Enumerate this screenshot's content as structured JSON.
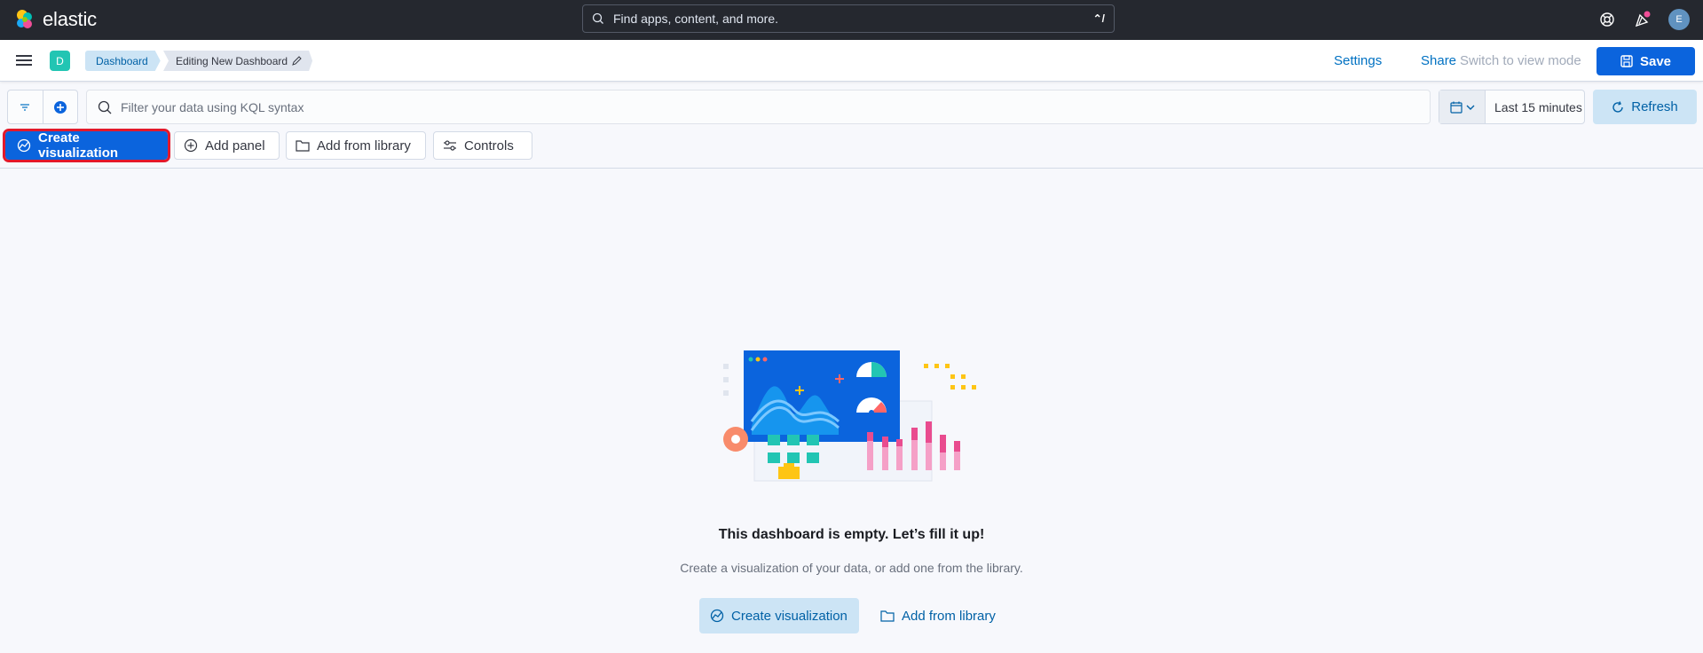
{
  "header": {
    "logo_text": "elastic",
    "search_placeholder": "Find apps, content, and more.",
    "search_shortcut": "⌃/",
    "avatar_initial": "E"
  },
  "app_bar": {
    "space_initial": "D",
    "breadcrumbs": [
      "Dashboard",
      "Editing New Dashboard"
    ],
    "settings_label": "Settings",
    "share_label": "Share",
    "view_mode_label": "Switch to view mode",
    "save_label": "Save"
  },
  "query_bar": {
    "placeholder": "Filter your data using KQL syntax",
    "time_range": "Last 15 minutes",
    "refresh_label": "Refresh"
  },
  "toolbar": {
    "create_visualization": "Create visualization",
    "add_panel": "Add panel",
    "add_from_library": "Add from library",
    "controls": "Controls"
  },
  "empty_state": {
    "title": "This dashboard is empty. Let’s fill it up!",
    "subtitle": "Create a visualization of your data, or add one from the library.",
    "create_label": "Create visualization",
    "library_label": "Add from library"
  },
  "colors": {
    "header_bg": "#25282f",
    "primary": "#0b64dd",
    "accent_teal": "#22c5b3",
    "highlight": "#e3192b"
  }
}
